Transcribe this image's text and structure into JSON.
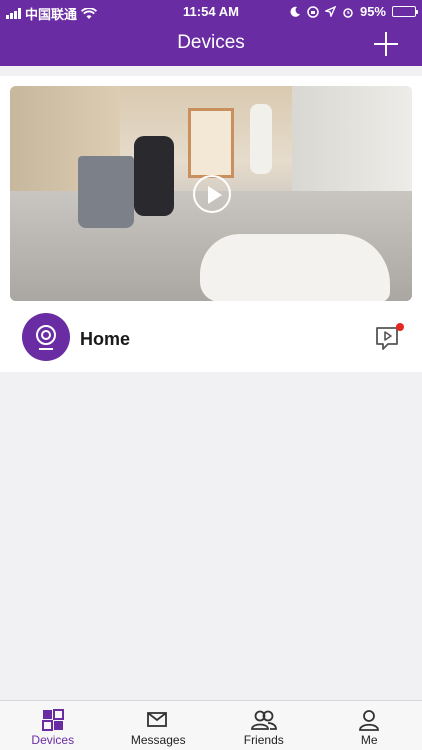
{
  "status_bar": {
    "carrier": "中国联通",
    "time": "11:54 AM",
    "battery": "95%",
    "battery_level": 0.95
  },
  "header": {
    "title": "Devices",
    "add_icon": "plus-icon"
  },
  "device": {
    "name": "Home",
    "thumbnail_icon": "play-icon",
    "avatar_icon": "camera-icon",
    "playback_icon": "video-playback-icon",
    "has_new": true
  },
  "tabs": [
    {
      "label": "Devices",
      "icon": "devices-icon",
      "active": true
    },
    {
      "label": "Messages",
      "icon": "messages-icon",
      "active": false
    },
    {
      "label": "Friends",
      "icon": "friends-icon",
      "active": false
    },
    {
      "label": "Me",
      "icon": "me-icon",
      "active": false
    }
  ],
  "colors": {
    "brand": "#6a2ca3",
    "background": "#f1f0f2",
    "badge": "#e5281f"
  }
}
